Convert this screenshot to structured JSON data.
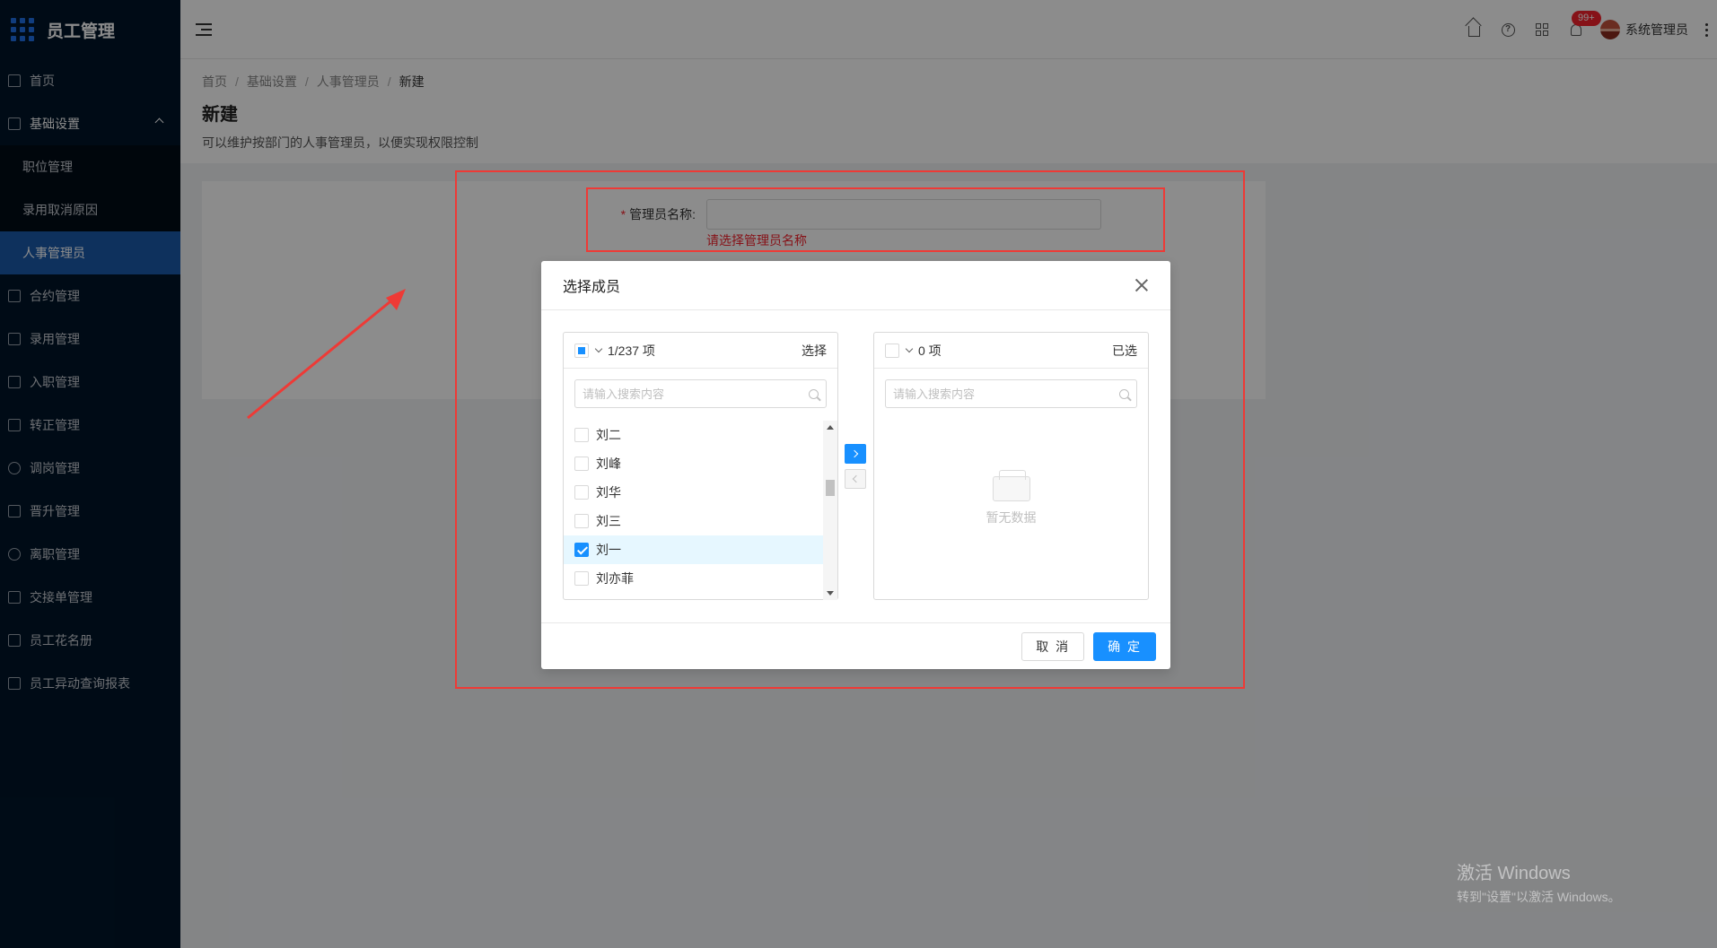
{
  "app": {
    "title": "员工管理"
  },
  "sidebar": {
    "items": [
      {
        "label": "首页",
        "icon": "home-icon"
      },
      {
        "label": "基础设置",
        "icon": "mail-icon",
        "open": true,
        "children": [
          "职位管理",
          "录用取消原因",
          "人事管理员"
        ]
      },
      {
        "label": "合约管理",
        "icon": "calendar-icon"
      },
      {
        "label": "录用管理",
        "icon": "form-icon"
      },
      {
        "label": "入职管理",
        "icon": "file-icon"
      },
      {
        "label": "转正管理",
        "icon": "transfer-icon"
      },
      {
        "label": "调岗管理",
        "icon": "user-icon"
      },
      {
        "label": "晋升管理",
        "icon": "chart-icon"
      },
      {
        "label": "离职管理",
        "icon": "user-leave-icon"
      },
      {
        "label": "交接单管理",
        "icon": "copy-icon"
      },
      {
        "label": "员工花名册",
        "icon": "roster-icon"
      },
      {
        "label": "员工异动查询报表",
        "icon": "report-icon"
      }
    ],
    "active_child": "人事管理员"
  },
  "header": {
    "badge": "99+",
    "user_name": "系统管理员"
  },
  "page": {
    "breadcrumb": [
      "首页",
      "基础设置",
      "人事管理员",
      "新建"
    ],
    "title": "新建",
    "description": "可以维护按部门的人事管理员，以便实现权限控制"
  },
  "form": {
    "label": "管理员名称:",
    "required_mark": "*",
    "error": "请选择管理员名称"
  },
  "modal": {
    "title": "选择成员",
    "left": {
      "count": "1/237 项",
      "title": "选择",
      "search_placeholder": "请输入搜索内容",
      "items": [
        {
          "name": "刘二",
          "checked": false
        },
        {
          "name": "刘峰",
          "checked": false
        },
        {
          "name": "刘华",
          "checked": false
        },
        {
          "name": "刘三",
          "checked": false
        },
        {
          "name": "刘一",
          "checked": true
        },
        {
          "name": "刘亦菲",
          "checked": false
        }
      ]
    },
    "right": {
      "count": "0 项",
      "title": "已选",
      "search_placeholder": "请输入搜索内容",
      "empty_text": "暂无数据"
    },
    "cancel": "取 消",
    "ok": "确 定"
  },
  "watermark": {
    "line1": "激活 Windows",
    "line2": "转到\"设置\"以激活 Windows。"
  },
  "colors": {
    "accent": "#1890ff",
    "sidebar": "#001529",
    "annotation": "#ee3a36",
    "error": "#f5222d"
  }
}
